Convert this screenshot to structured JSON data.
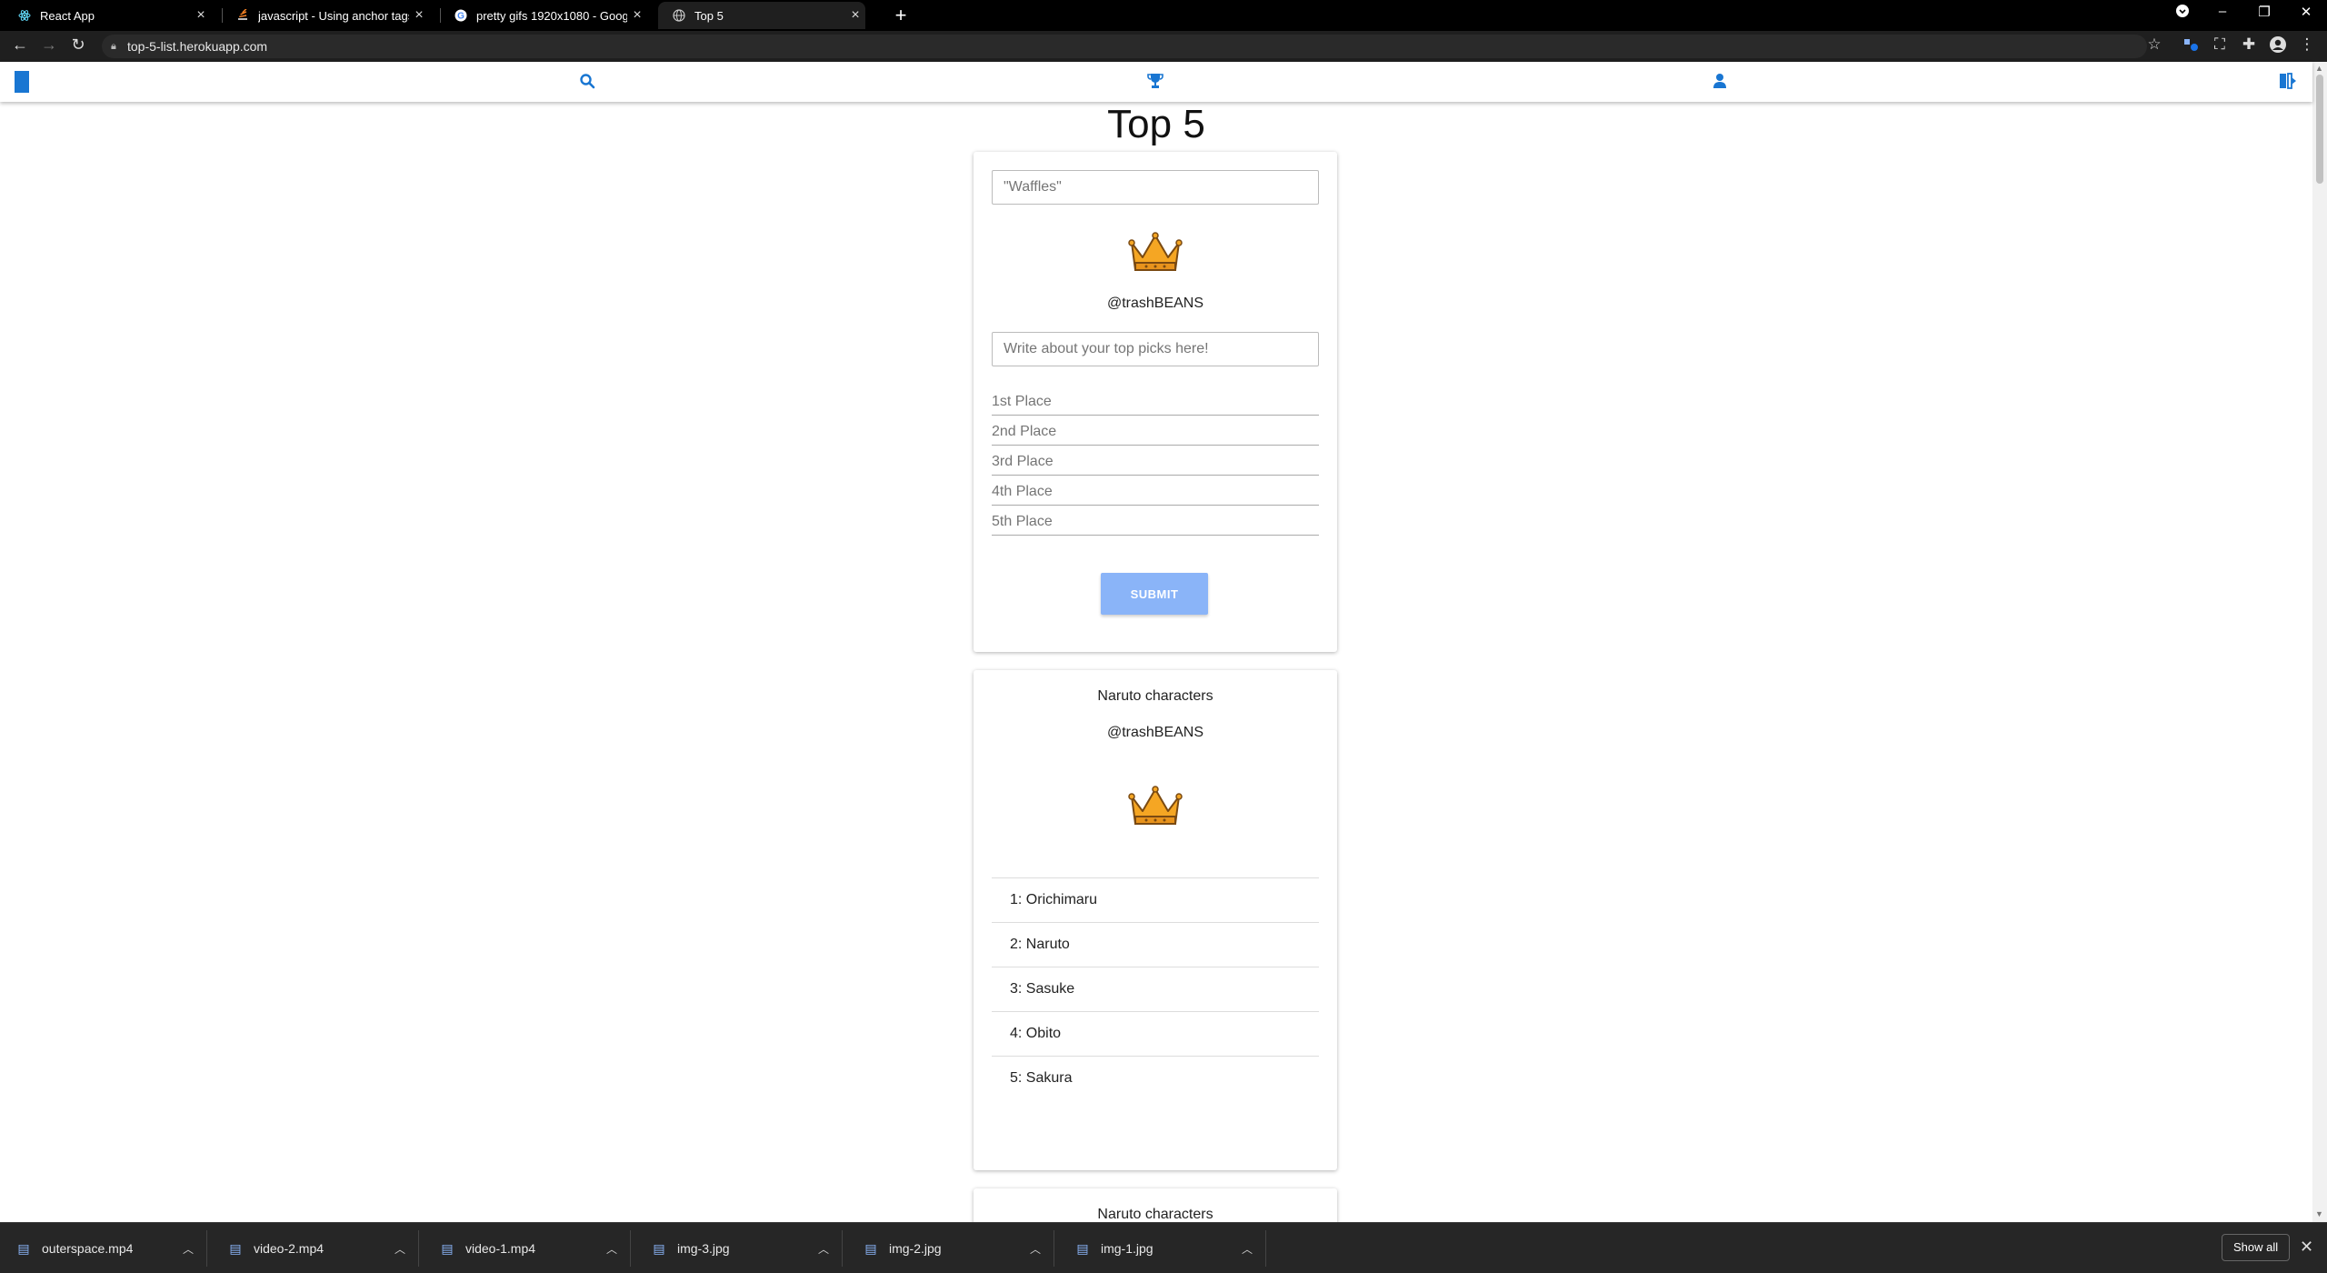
{
  "browser": {
    "tabs": [
      {
        "title": "React App",
        "icon": "react-icon"
      },
      {
        "title": "javascript - Using anchor tags in",
        "icon": "stackoverflow-icon"
      },
      {
        "title": "pretty gifs 1920x1080 - Google S",
        "icon": "google-icon"
      },
      {
        "title": "Top 5",
        "icon": "globe-icon",
        "active": true
      }
    ],
    "url": "top-5-list.herokuapp.com"
  },
  "app": {
    "accent": "#1976d2",
    "nav_icons": [
      "menu-block-icon",
      "search-icon",
      "trophy-icon",
      "user-icon",
      "logout-icon"
    ]
  },
  "page": {
    "title": "Top 5",
    "form": {
      "title_placeholder": "\"Waffles\"",
      "handle": "@trashBEANS",
      "description_placeholder": "Write about your top picks here!",
      "places": [
        "1st Place",
        "2nd Place",
        "3rd Place",
        "4th Place",
        "5th Place"
      ],
      "submit_label": "SUBMIT",
      "submit_color": "#8ab4f8"
    },
    "lists": [
      {
        "title": "Naruto characters",
        "handle": "@trashBEANS",
        "items": [
          "1: Orichimaru",
          "2: Naruto",
          "3: Sasuke",
          "4: Obito",
          "5: Sakura"
        ]
      },
      {
        "title": "Naruto characters"
      }
    ]
  },
  "downloads": {
    "items": [
      "outerspace.mp4",
      "video-2.mp4",
      "video-1.mp4",
      "img-3.jpg",
      "img-2.jpg",
      "img-1.jpg"
    ],
    "show_all_label": "Show all"
  }
}
